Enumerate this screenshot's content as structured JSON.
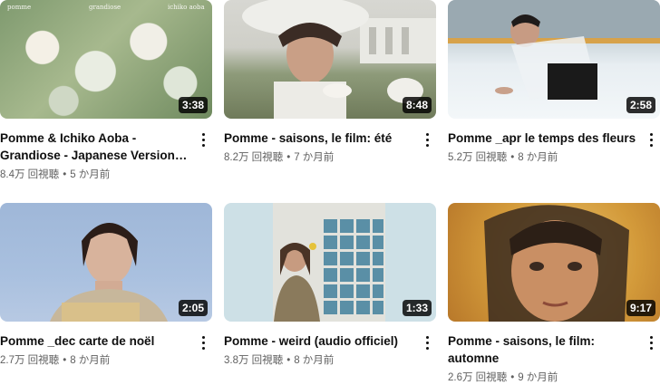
{
  "videos": [
    {
      "title": "Pomme & Ichiko Aoba - Grandiose - Japanese Version (Official Lyrics...",
      "duration": "3:38",
      "views": "8.4万 回視聴",
      "age": "5 か月前",
      "thumb_captions": [
        "pomme",
        "grandiose",
        "ichiko aoba"
      ]
    },
    {
      "title": "Pomme - saisons, le film: été",
      "duration": "8:48",
      "views": "8.2万 回視聴",
      "age": "7 か月前"
    },
    {
      "title": "Pomme _apr le temps des fleurs",
      "duration": "2:58",
      "views": "5.2万 回視聴",
      "age": "8 か月前"
    },
    {
      "title": "Pomme _dec carte de noël",
      "duration": "2:05",
      "views": "2.7万 回視聴",
      "age": "8 か月前"
    },
    {
      "title": "Pomme - weird (audio officiel)",
      "duration": "1:33",
      "views": "3.8万 回視聴",
      "age": "8 か月前"
    },
    {
      "title": "Pomme - saisons, le film: automne",
      "duration": "9:17",
      "views": "2.6万 回視聴",
      "age": "9 か月前"
    }
  ],
  "separator": "•"
}
